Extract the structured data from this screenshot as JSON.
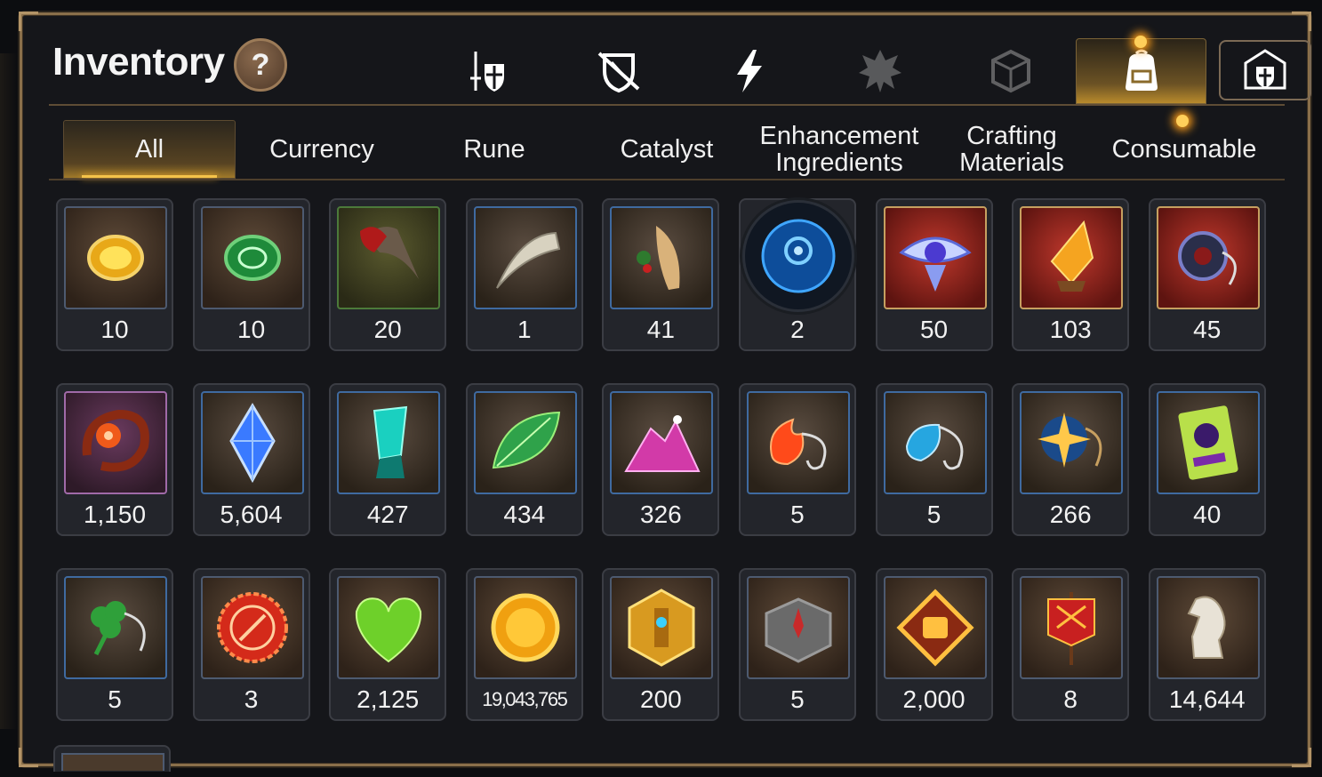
{
  "header": {
    "title": "Inventory",
    "help_label": "?"
  },
  "top_tabs": [
    {
      "name": "equipment-tab",
      "icon": "sword-shield-icon",
      "active": false
    },
    {
      "name": "armor-tab",
      "icon": "broken-shield-icon",
      "active": false
    },
    {
      "name": "skill-tab",
      "icon": "lightning-icon",
      "active": false
    },
    {
      "name": "emblem-tab",
      "icon": "crest-icon",
      "active": false
    },
    {
      "name": "box-tab",
      "icon": "cube-icon",
      "active": false
    },
    {
      "name": "bag-tab",
      "icon": "backpack-icon",
      "active": true
    },
    {
      "name": "guild-storage-tab",
      "icon": "storage-icon",
      "active": false
    }
  ],
  "sub_tabs": [
    {
      "label": "All",
      "active": true
    },
    {
      "label": "Currency",
      "active": false
    },
    {
      "label": "Rune",
      "active": false
    },
    {
      "label": "Catalyst",
      "active": false
    },
    {
      "label": "Enhancement Ingredients",
      "active": false
    },
    {
      "label": "Crafting Materials",
      "active": false
    },
    {
      "label": "Consumable",
      "active": false
    }
  ],
  "items": [
    {
      "icon": "yellow-gem-icon",
      "count": "10"
    },
    {
      "icon": "green-gem-icon",
      "count": "10"
    },
    {
      "icon": "claw-icon",
      "count": "20"
    },
    {
      "icon": "fang-icon",
      "count": "1"
    },
    {
      "icon": "ginseng-root-icon",
      "count": "41"
    },
    {
      "icon": "blue-rune-orb-icon",
      "count": "2"
    },
    {
      "icon": "crystal-eye-icon",
      "count": "50"
    },
    {
      "icon": "orange-crystal-icon",
      "count": "103"
    },
    {
      "icon": "dark-ring-amulet-icon",
      "count": "45"
    },
    {
      "icon": "red-flower-ring-icon",
      "count": "1,150"
    },
    {
      "icon": "blue-diamond-icon",
      "count": "5,604"
    },
    {
      "icon": "teal-crystal-icon",
      "count": "427"
    },
    {
      "icon": "green-leaf-icon",
      "count": "434"
    },
    {
      "icon": "pink-ore-icon",
      "count": "326"
    },
    {
      "icon": "fire-pendant-icon",
      "count": "5"
    },
    {
      "icon": "water-pendant-icon",
      "count": "5"
    },
    {
      "icon": "star-pendant-icon",
      "count": "266"
    },
    {
      "icon": "card-icon",
      "count": "40"
    },
    {
      "icon": "clover-pendant-icon",
      "count": "5"
    },
    {
      "icon": "red-seal-icon",
      "count": "3"
    },
    {
      "icon": "green-heart-icon",
      "count": "2,125"
    },
    {
      "icon": "gold-coin-icon",
      "count": "19,043,765"
    },
    {
      "icon": "gold-emblem-icon",
      "count": "200"
    },
    {
      "icon": "stone-compass-icon",
      "count": "5"
    },
    {
      "icon": "fist-badge-icon",
      "count": "2,000"
    },
    {
      "icon": "battle-flag-icon",
      "count": "8"
    },
    {
      "icon": "knight-chess-icon",
      "count": "14,644"
    }
  ],
  "colors": {
    "accent": "#f5c34a",
    "frame": "#8a6f4a",
    "background": "#15161a"
  }
}
